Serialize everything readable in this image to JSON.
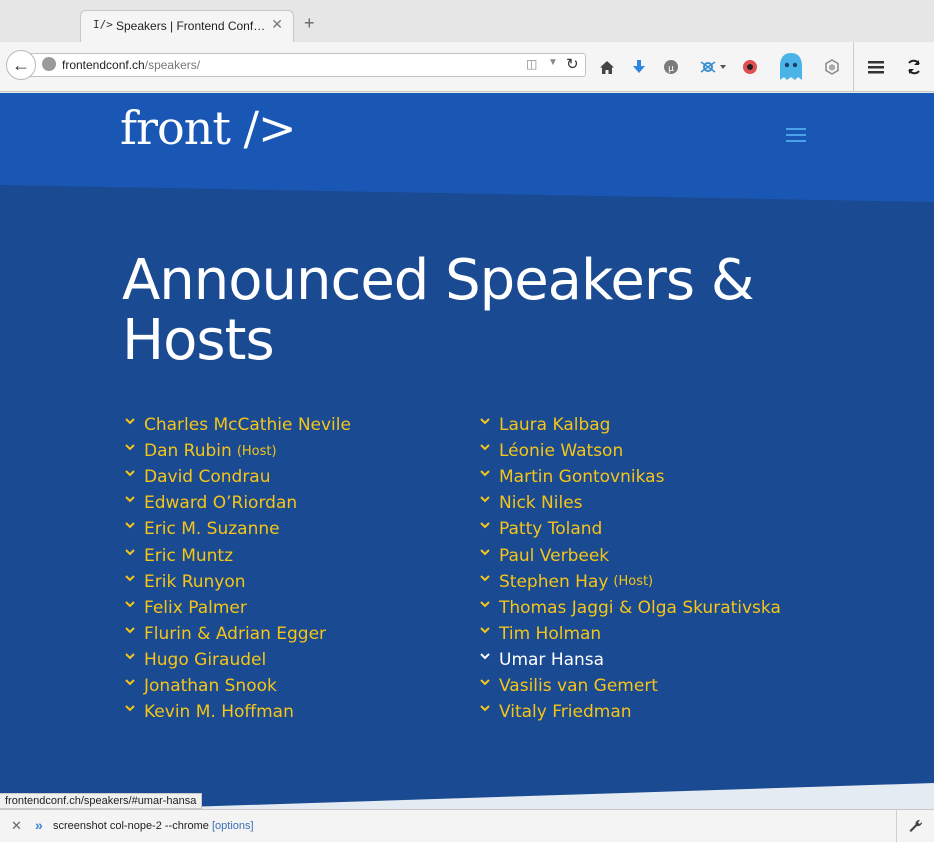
{
  "browser": {
    "tab_favicon": "I/>",
    "tab_title": "Speakers | Frontend Conference Zurich",
    "tab_close": "✕",
    "new_tab": "+",
    "url_host": "frontendconf.ch",
    "url_path": "/speakers/",
    "status_url": "frontendconf.ch/speakers/#umar-hansa"
  },
  "site": {
    "logo": "front />",
    "heading": "Announced Speakers & Hosts"
  },
  "speakers_left": [
    {
      "name": "Charles McCathie Nevile",
      "role": ""
    },
    {
      "name": "Dan Rubin",
      "role": "(Host)"
    },
    {
      "name": "David Condrau",
      "role": ""
    },
    {
      "name": "Edward O’Riordan",
      "role": ""
    },
    {
      "name": "Eric M. Suzanne",
      "role": ""
    },
    {
      "name": "Eric Muntz",
      "role": ""
    },
    {
      "name": "Erik Runyon",
      "role": ""
    },
    {
      "name": "Felix Palmer",
      "role": ""
    },
    {
      "name": "Flurin & Adrian Egger",
      "role": ""
    },
    {
      "name": "Hugo Giraudel",
      "role": ""
    },
    {
      "name": "Jonathan Snook",
      "role": ""
    },
    {
      "name": "Kevin M. Hoffman",
      "role": ""
    }
  ],
  "speakers_right": [
    {
      "name": "Laura Kalbag",
      "role": ""
    },
    {
      "name": "Léonie Watson",
      "role": ""
    },
    {
      "name": "Martin Gontovnikas",
      "role": ""
    },
    {
      "name": "Nick Niles",
      "role": ""
    },
    {
      "name": "Patty Toland",
      "role": ""
    },
    {
      "name": "Paul Verbeek",
      "role": ""
    },
    {
      "name": "Stephen Hay",
      "role": "(Host)"
    },
    {
      "name": "Thomas Jaggi & Olga Skurativska",
      "role": ""
    },
    {
      "name": "Tim Holman",
      "role": ""
    },
    {
      "name": "Umar Hansa",
      "role": "",
      "hovered": true
    },
    {
      "name": "Vasilis van Gemert",
      "role": ""
    },
    {
      "name": "Vitaly Friedman",
      "role": ""
    }
  ],
  "devtools": {
    "close": "✕",
    "prompt": "»",
    "command": "screenshot col-nope-2 --chrome",
    "options": "[options]"
  },
  "colors": {
    "page_bg": "#1a4a91",
    "header_bg": "#1a57b4",
    "link": "#f5c518",
    "link_hover": "#ffffff"
  },
  "icons": {
    "back": "back-arrow-icon",
    "home": "home-icon",
    "download": "download-icon",
    "ublock": "ublock-icon",
    "network": "network-icon",
    "ghostery": "ghostery-icon",
    "menu": "hamburger-menu-icon",
    "sync": "sync-icon",
    "chevron": "chevron-down-icon"
  }
}
